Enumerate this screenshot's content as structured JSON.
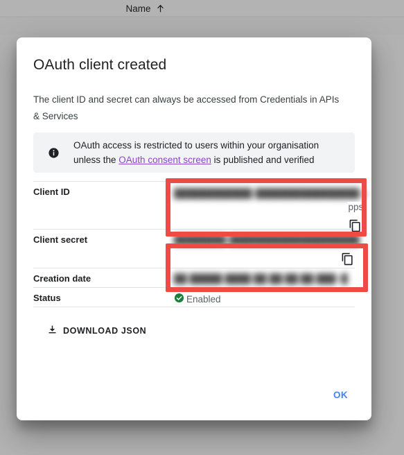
{
  "background": {
    "table_header": {
      "column_label": "Name",
      "sort_icon": "arrow-up-icon"
    }
  },
  "dialog": {
    "title": "OAuth client created",
    "subtitle": "The client ID and secret can always be accessed from Credentials in APIs & Services",
    "info_banner": {
      "icon": "info-icon",
      "text_before": "OAuth access is restricted to users within your organisation unless the ",
      "link_text": "OAuth consent screen",
      "text_after": " is published and verified"
    },
    "details": {
      "client_id": {
        "label": "Client ID",
        "value_redacted": "████████████-████████████████.a",
        "value_tail": "pps",
        "copy_icon": "copy-icon"
      },
      "client_secret": {
        "label": "Client secret",
        "value_redacted": "████████-████████████████████",
        "copy_icon": "copy-icon"
      },
      "creation_date": {
        "label": "Creation date",
        "value_redacted": "██ █████ ████ ██ ██:██:██ ███+█"
      },
      "status": {
        "label": "Status",
        "value": "Enabled",
        "icon": "check-circle-icon",
        "icon_color": "#188038"
      }
    },
    "download_json": {
      "label": "DOWNLOAD JSON",
      "icon": "download-icon"
    },
    "ok_button": {
      "label": "OK",
      "color": "#4285f4"
    }
  },
  "annotations": {
    "highlight_color": "#ee4a47",
    "boxes": [
      {
        "name": "client-id-highlight"
      },
      {
        "name": "client-secret-highlight"
      }
    ]
  }
}
